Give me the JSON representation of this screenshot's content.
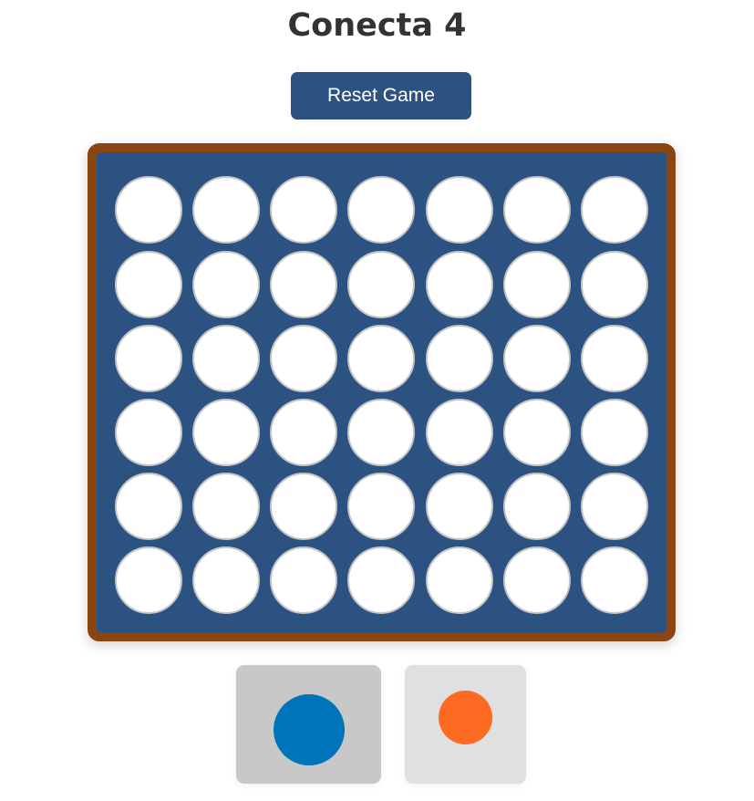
{
  "title": "Conecta 4",
  "reset_label": "Reset Game",
  "board": {
    "rows": 6,
    "columns": 7,
    "cells": [
      [
        "empty",
        "empty",
        "empty",
        "empty",
        "empty",
        "empty",
        "empty"
      ],
      [
        "empty",
        "empty",
        "empty",
        "empty",
        "empty",
        "empty",
        "empty"
      ],
      [
        "empty",
        "empty",
        "empty",
        "empty",
        "empty",
        "empty",
        "empty"
      ],
      [
        "empty",
        "empty",
        "empty",
        "empty",
        "empty",
        "empty",
        "empty"
      ],
      [
        "empty",
        "empty",
        "empty",
        "empty",
        "empty",
        "empty",
        "empty"
      ],
      [
        "empty",
        "empty",
        "empty",
        "empty",
        "empty",
        "empty",
        "empty"
      ]
    ]
  },
  "players": [
    {
      "color": "#0074b8",
      "active": true
    },
    {
      "color": "#ff6a23",
      "active": false
    }
  ],
  "colors": {
    "board": "#2c5282",
    "frame": "#8b4513",
    "button": "#2c5282"
  }
}
